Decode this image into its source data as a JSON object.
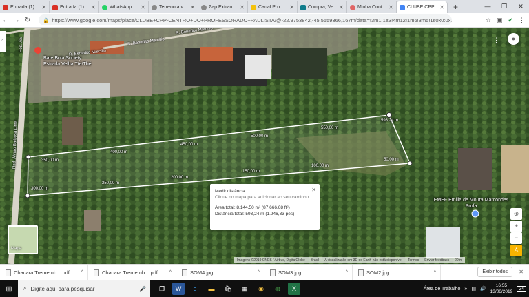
{
  "browser": {
    "tabs": [
      {
        "label": "Entrada (1)",
        "color": "#d93025"
      },
      {
        "label": "Entrada (1)",
        "color": "#d93025"
      },
      {
        "label": "WhatsApp",
        "color": "#25d366"
      },
      {
        "label": "Terreno à v",
        "color": "#555555"
      },
      {
        "label": "Zap Extran",
        "color": "#555555"
      },
      {
        "label": "Canal Pro",
        "color": "#f4c20d"
      },
      {
        "label": "Compra, Ve",
        "color": "#0f7c8c"
      },
      {
        "label": "Minha Cont",
        "color": "#e06666"
      },
      {
        "label": "CLUBE CPP",
        "color": "#4285f4"
      }
    ],
    "new_tab": "+",
    "url": "https://www.google.com/maps/place/CLUBE+CPP-CENTRO+DO+PROFESSORADO+PAULISTA/@-22.9753842,-45.5559366,167m/data=!3m1!1e3!4m12!1m6!3m5!1s0x0:0x..."
  },
  "map": {
    "streets": {
      "road_top_1": "R. Benedito Marcílio",
      "road_top_2": "R. Benedito Marcílio",
      "road_top_3": "R. Benedito Marcílio",
      "road_left": "Rod. Álvaro Barbosa Lima",
      "road_left_top": "Rod. Álv"
    },
    "poi_bate_bola": "Bate Bola Society",
    "poi_bate_bola_sub": "Estrada Velha Tte/Tbé",
    "poi_school": "EMEF Emilia de Moura Marcondes Profa",
    "distance_labels": [
      "50,00 m",
      "100,00 m",
      "150,00 m",
      "200,00 m",
      "250,00 m",
      "300,00 m",
      "350,00 m",
      "400,00 m",
      "450,00 m",
      "500,00 m",
      "550,00 m",
      "593,24 m"
    ],
    "mini_map_label": "Mapa",
    "footer": [
      "Imagens ©2019 CNES / Airbus, DigitalGlobe",
      "Brasil",
      "A visualização em 3D do Earth não está disponível",
      "Termos",
      "Enviar feedback",
      "20 m"
    ]
  },
  "measure": {
    "title": "Medir distância",
    "hint": "Clique no mapa para adicionar ao seu caminho",
    "area": "Área total: 8.144,50 m² (87.666,68 ft²)",
    "distance": "Distância total: 593,24 m (1.946,33 pés)"
  },
  "downloads": {
    "items": [
      "Chacara Trememb....pdf",
      "Chacara Trememb....pdf",
      "SOM4.jpg",
      "SOM3.jpg",
      "SOM2.jpg"
    ],
    "show_all": "Exibir todos"
  },
  "taskbar": {
    "search_placeholder": "Digite aqui para pesquisar",
    "desktop_label": "Área de Trabalho",
    "time": "16:55",
    "date": "13/06/2019",
    "badge": "24"
  }
}
